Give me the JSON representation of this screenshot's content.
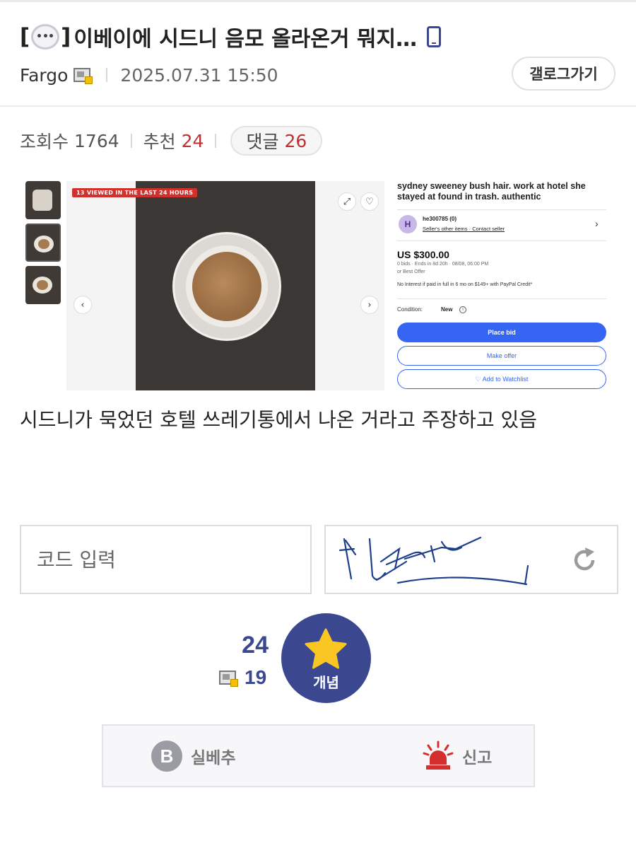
{
  "post": {
    "title": "이베이에 시드니 음모 올라온거 뭐지…",
    "author": "Fargo",
    "date": "2025.07.31 15:50",
    "gallery_button": "갤로그가기",
    "stats": {
      "views_label": "조회수",
      "views": "1764",
      "recommend_label": "추천",
      "recommend": "24",
      "comments_label": "댓글",
      "comments": "26"
    },
    "body_text": "시드니가 묵었던 호텔 쓰레기통에서 나온 거라고 주장하고 있음"
  },
  "listing": {
    "views_badge": "13 VIEWED IN THE LAST 24 HOURS",
    "title": "sydney sweeney bush hair. work at hotel she stayed at found in trash. authentic",
    "seller_initial": "H",
    "seller_name": "he300785 (0)",
    "seller_links": "Seller's other items · Contact seller",
    "price": "US $300.00",
    "bids": "0 bids · Ends in 8d 20h · 08/08, 06:00 PM",
    "best_offer": "or Best Offer",
    "interest": "No Interest if paid in full in 6 mo on $149+ with PayPal Credit*",
    "condition_label": "Condition:",
    "condition_value": "New",
    "place_bid": "Place bid",
    "make_offer": "Make offer",
    "watchlist": "♡ Add to Watchlist"
  },
  "captcha": {
    "placeholder": "코드 입력"
  },
  "recommend": {
    "count": "24",
    "fixed_count": "19",
    "button_label": "개념"
  },
  "actions": {
    "downvote_icon_letter": "B",
    "downvote_label": "실베추",
    "report_label": "신고"
  },
  "colors": {
    "accent": "#3b4890",
    "count_red": "#b33333",
    "star": "#f9c623",
    "report_red": "#d32f2f",
    "ebay_blue": "#3665f3"
  },
  "icons": [
    "chat-bubble-icon",
    "mobile-icon",
    "fixed-user-icon",
    "expand-icon",
    "heart-icon",
    "chevron-left-icon",
    "chevron-right-icon",
    "refresh-icon",
    "star-icon",
    "siren-icon"
  ]
}
